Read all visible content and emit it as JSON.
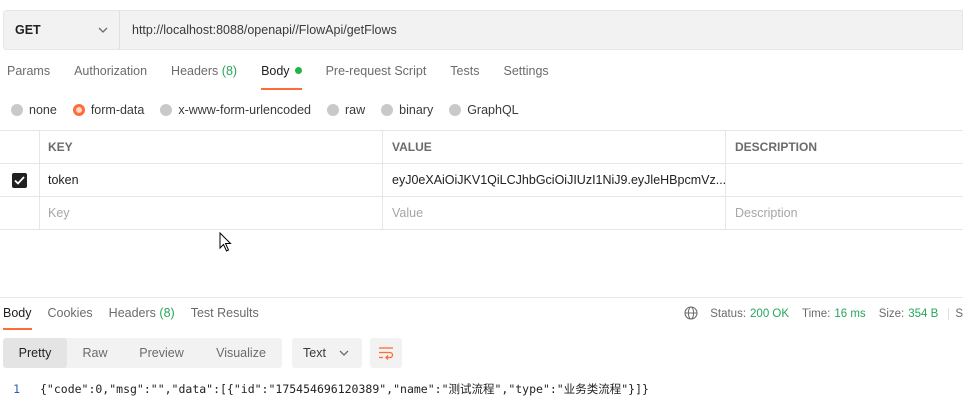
{
  "request": {
    "method": "GET",
    "url": "http://localhost:8088/openapi//FlowApi/getFlows"
  },
  "request_tabs": [
    {
      "label": "Params"
    },
    {
      "label": "Authorization"
    },
    {
      "label": "Headers",
      "count": "(8)"
    },
    {
      "label": "Body"
    },
    {
      "label": "Pre-request Script"
    },
    {
      "label": "Tests"
    },
    {
      "label": "Settings"
    }
  ],
  "body_types": [
    "none",
    "form-data",
    "x-www-form-urlencoded",
    "raw",
    "binary",
    "GraphQL"
  ],
  "body_type_selected": "form-data",
  "table": {
    "headers": [
      "KEY",
      "VALUE",
      "DESCRIPTION"
    ],
    "rows": [
      {
        "checked": true,
        "key": "token",
        "value": "eyJ0eXAiOiJKV1QiLCJhbGciOiJIUzI1NiJ9.eyJleHBpcmVz...",
        "description": ""
      }
    ],
    "placeholders": {
      "key": "Key",
      "value": "Value",
      "description": "Description"
    }
  },
  "response_tabs": [
    {
      "label": "Body"
    },
    {
      "label": "Cookies"
    },
    {
      "label": "Headers",
      "count": "(8)"
    },
    {
      "label": "Test Results"
    }
  ],
  "response_status": {
    "status_label": "Status:",
    "status_value": "200 OK",
    "time_label": "Time:",
    "time_value": "16 ms",
    "size_label": "Size:",
    "size_value": "354 B",
    "cut_text": "S"
  },
  "view_modes": [
    "Pretty",
    "Raw",
    "Preview",
    "Visualize"
  ],
  "format": "Text",
  "code_lines": [
    {
      "number": "1",
      "text": "{\"code\":0,\"msg\":\"\",\"data\":[{\"id\":\"175454696120389\",\"name\":\"测试流程\",\"type\":\"业务类流程\"}]}"
    }
  ],
  "colors": {
    "accent": "#ff6c37",
    "success": "#26a65b"
  },
  "icons": [
    "chevron-down-icon",
    "check-icon",
    "globe-icon",
    "wrap-lines-icon",
    "mouse-cursor-icon"
  ]
}
